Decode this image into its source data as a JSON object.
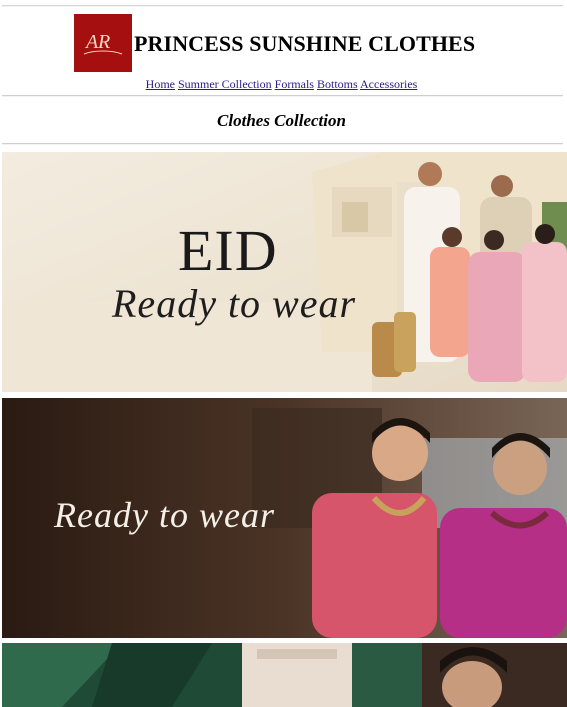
{
  "header": {
    "logo_text": "AR",
    "title": "PRINCESS SUNSHINE CLOTHES"
  },
  "nav": {
    "items": [
      "Home",
      "Summer Collection",
      "Formals",
      "Bottoms",
      "Accessories"
    ]
  },
  "collection": {
    "title": "Clothes Collection"
  },
  "banners": {
    "banner1": {
      "headline": "EID",
      "script": "Ready to wear"
    },
    "banner2": {
      "script": "Ready to wear"
    }
  },
  "colors": {
    "logo_bg": "#a50f0f",
    "nav_link": "#2a1a8a"
  }
}
